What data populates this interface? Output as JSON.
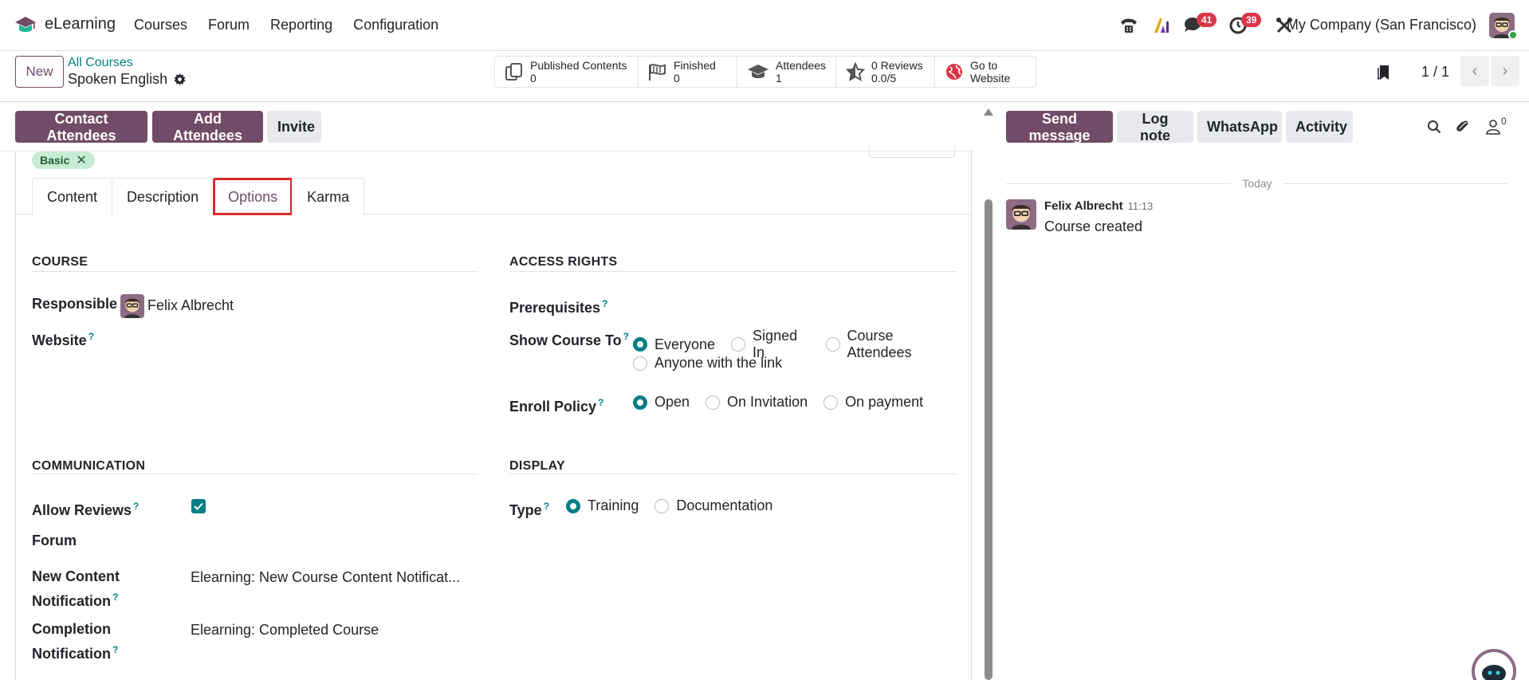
{
  "navbar": {
    "app_name": "eLearning",
    "menu": [
      "Courses",
      "Forum",
      "Reporting",
      "Configuration"
    ],
    "badges": {
      "messages": "41",
      "activities": "39"
    },
    "company": "My Company (San Francisco)"
  },
  "control_panel": {
    "new_label": "New",
    "breadcrumb_parent": "All Courses",
    "breadcrumb_current": "Spoken English",
    "stats": [
      {
        "label": "Published Contents",
        "value": "0",
        "icon": "copy-icon"
      },
      {
        "label": "Finished",
        "value": "0",
        "icon": "flag-icon"
      },
      {
        "label": "Attendees",
        "value": "1",
        "icon": "graduation-cap-icon"
      },
      {
        "label": "0 Reviews",
        "value": "0.0/5",
        "icon": "star-icon"
      },
      {
        "label": "Go to",
        "value": "Website",
        "icon": "globe-icon"
      }
    ],
    "pager": "1 / 1"
  },
  "form_toolbar": {
    "contact_label": "Contact Attendees",
    "add_label": "Add Attendees",
    "invite_label": "Invite"
  },
  "form": {
    "tag": "Basic",
    "tabs": [
      "Content",
      "Description",
      "Options",
      "Karma"
    ],
    "active_tab": "Options",
    "course": {
      "title": "COURSE",
      "responsible_label": "Responsible",
      "responsible_value": "Felix Albrecht",
      "website_label": "Website"
    },
    "access": {
      "title": "ACCESS RIGHTS",
      "prerequisites_label": "Prerequisites",
      "show_label": "Show Course To",
      "show_options": [
        "Everyone",
        "Signed In",
        "Course Attendees",
        "Anyone with the link"
      ],
      "show_selected": "Everyone",
      "enroll_label": "Enroll Policy",
      "enroll_options": [
        "Open",
        "On Invitation",
        "On payment"
      ],
      "enroll_selected": "Open"
    },
    "communication": {
      "title": "COMMUNICATION",
      "reviews_label": "Allow Reviews",
      "reviews_checked": true,
      "forum_label": "Forum",
      "new_content_label_1": "New Content",
      "new_content_label_2": "Notification",
      "new_content_value": "Elearning: New Course Content Notificat...",
      "completion_label_1": "Completion",
      "completion_label_2": "Notification",
      "completion_value": "Elearning: Completed Course"
    },
    "display": {
      "title": "DISPLAY",
      "type_label": "Type",
      "type_options": [
        "Training",
        "Documentation"
      ],
      "type_selected": "Training"
    }
  },
  "chatter": {
    "send_label": "Send message",
    "log_label": "Log note",
    "whatsapp_label": "WhatsApp",
    "activity_label": "Activity",
    "followers_count": "0",
    "today_label": "Today",
    "message": {
      "author": "Felix Albrecht",
      "time": "11:13",
      "body": "Course created"
    }
  },
  "colors": {
    "brand": "#714b67",
    "accent": "#017e84",
    "badge": "#d9364a"
  }
}
